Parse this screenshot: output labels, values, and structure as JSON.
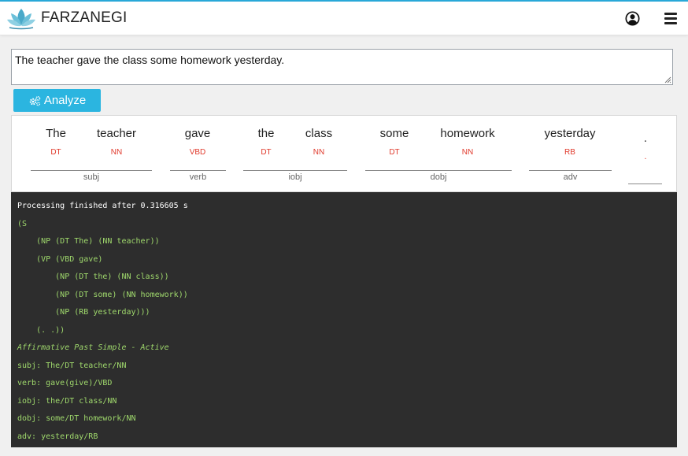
{
  "brand": {
    "name": "FARZANEGI",
    "logo_icon": "lotus-icon"
  },
  "header_icons": {
    "user": "user-circle-icon",
    "menu": "hamburger-menu-icon"
  },
  "input": {
    "value": "The teacher gave the class some homework yesterday."
  },
  "analyze_button": {
    "label": "Analyze",
    "icon": "gears-icon",
    "color": "#2bb5e0"
  },
  "parse": {
    "tokens": [
      {
        "word": "The",
        "tag": "DT"
      },
      {
        "word": "teacher",
        "tag": "NN"
      },
      {
        "word": "gave",
        "tag": "VBD"
      },
      {
        "word": "the",
        "tag": "DT"
      },
      {
        "word": "class",
        "tag": "NN"
      },
      {
        "word": "some",
        "tag": "DT"
      },
      {
        "word": "homework",
        "tag": "NN"
      },
      {
        "word": "yesterday",
        "tag": "RB"
      },
      {
        "word": ".",
        "tag": "."
      }
    ],
    "relations": [
      "subj",
      "verb",
      "iobj",
      "dobj",
      "adv"
    ],
    "tag_color": "#e0392b"
  },
  "output": {
    "lines": [
      "Processing finished after 0.316605 s",
      "(S",
      "    (NP (DT The) (NN teacher))",
      "    (VP (VBD gave)",
      "        (NP (DT the) (NN class))",
      "        (NP (DT some) (NN homework))",
      "        (NP (RB yesterday)))",
      "    (. .))",
      "Affirmative Past Simple - Active",
      "subj: The/DT teacher/NN",
      "verb: gave(give)/VBD",
      "iobj: the/DT class/NN",
      "dobj: some/DT homework/NN",
      "adv: yesterday/RB"
    ],
    "text_color": "#9fd86c",
    "background": "#2d2d2d"
  }
}
